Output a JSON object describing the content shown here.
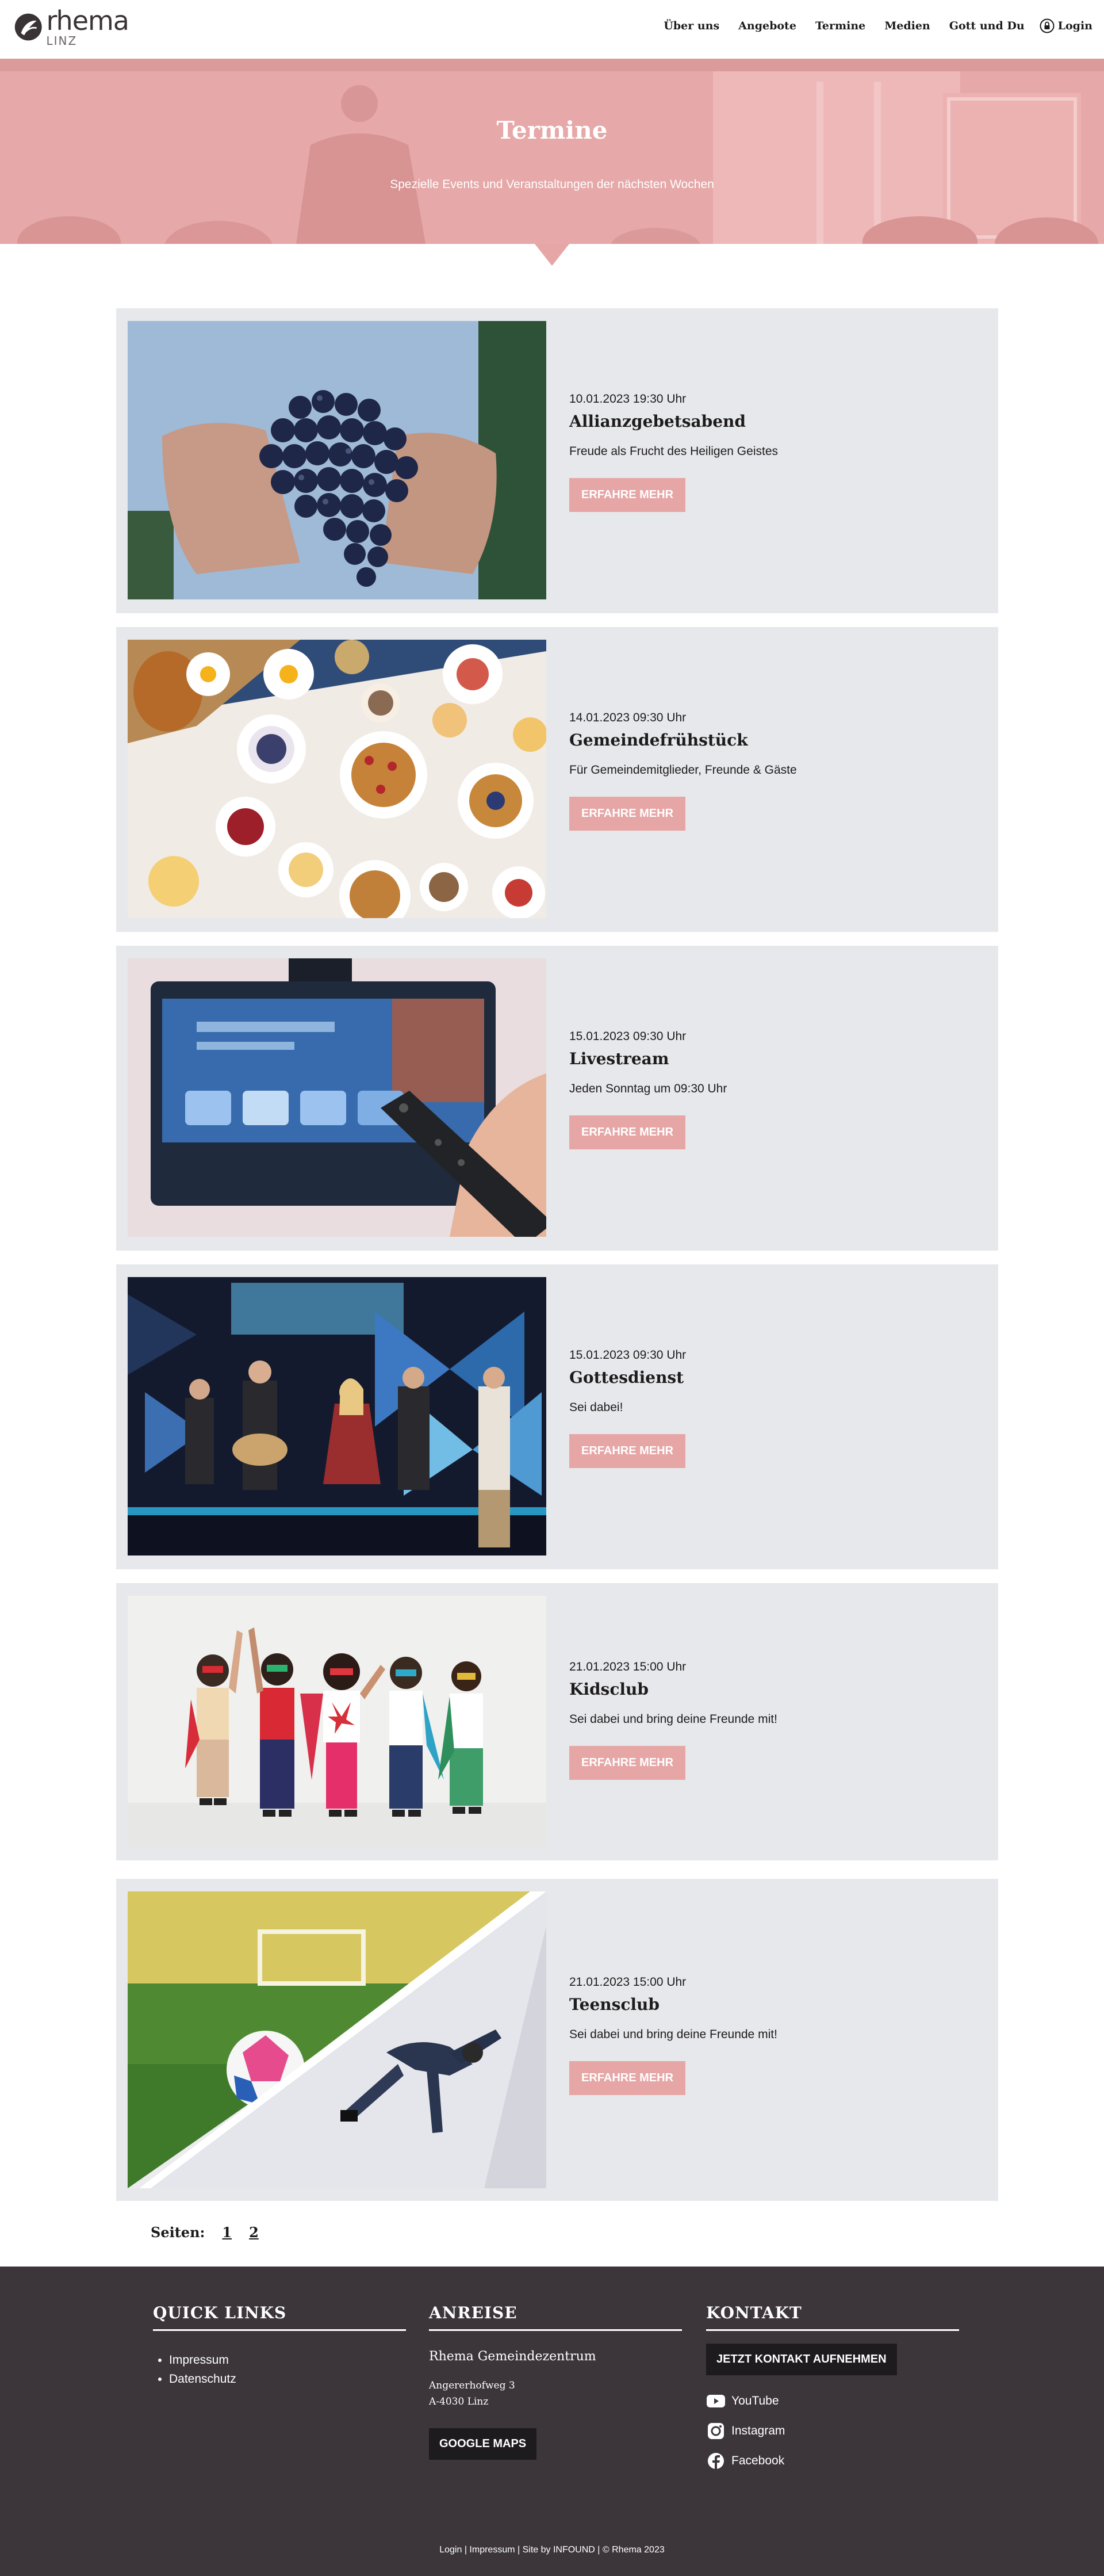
{
  "header": {
    "logo_word": "rhema",
    "logo_sub": "LINZ",
    "nav": [
      "Über uns",
      "Angebote",
      "Termine",
      "Medien",
      "Gott und Du"
    ],
    "login": "Login"
  },
  "hero": {
    "title": "Termine",
    "subtitle": "Spezielle Events und Veranstaltungen der nächsten Wochen"
  },
  "events": [
    {
      "date": "10.01.2023 19:30 Uhr",
      "title": "Allianzgebetsabend",
      "desc": "Freude als Frucht des Heiligen Geistes",
      "button": "ERFAHRE MEHR",
      "image": "grapes-in-hands"
    },
    {
      "date": "14.01.2023 09:30 Uhr",
      "title": "Gemeindefrühstück",
      "desc": "Für Gemeindemitglieder, Freunde & Gäste",
      "button": "ERFAHRE MEHR",
      "image": "breakfast-table"
    },
    {
      "date": "15.01.2023 09:30 Uhr",
      "title": "Livestream",
      "desc": "Jeden Sonntag um 09:30 Uhr",
      "button": "ERFAHRE MEHR",
      "image": "tv-remote"
    },
    {
      "date": "15.01.2023 09:30 Uhr",
      "title": "Gottesdienst",
      "desc": "Sei dabei!",
      "button": "ERFAHRE MEHR",
      "image": "worship-band"
    },
    {
      "date": "21.01.2023 15:00 Uhr",
      "title": "Kidsclub",
      "desc": "Sei dabei und bring deine Freunde mit!",
      "button": "ERFAHRE MEHR",
      "image": "kids-superheroes"
    },
    {
      "date": "21.01.2023 15:00 Uhr",
      "title": "Teensclub",
      "desc": "Sei dabei und bring deine Freunde mit!",
      "button": "ERFAHRE MEHR",
      "image": "soccer-and-breakdance"
    }
  ],
  "pagination": {
    "label": "Seiten:",
    "pages": [
      "1",
      "2"
    ]
  },
  "footer": {
    "quicklinks": {
      "heading": "QUICK LINKS",
      "items": [
        "Impressum",
        "Datenschutz"
      ]
    },
    "anreise": {
      "heading": "ANREISE",
      "name": "Rhema Gemeindezentrum",
      "street": "Angererhofweg 3",
      "city": "A-4030 Linz",
      "button": "GOOGLE MAPS"
    },
    "kontakt": {
      "heading": "KONTAKT",
      "button": "JETZT KONTAKT AUFNEHMEN",
      "socials": [
        "YouTube",
        "Instagram",
        "Facebook"
      ]
    },
    "bottom": "Login | Impressum |  Site by INFOUND | © Rhema 2023"
  },
  "colors": {
    "accent": "#e6a6a6",
    "card_bg": "#e6e8eb",
    "footer_bg": "#3c363b"
  }
}
